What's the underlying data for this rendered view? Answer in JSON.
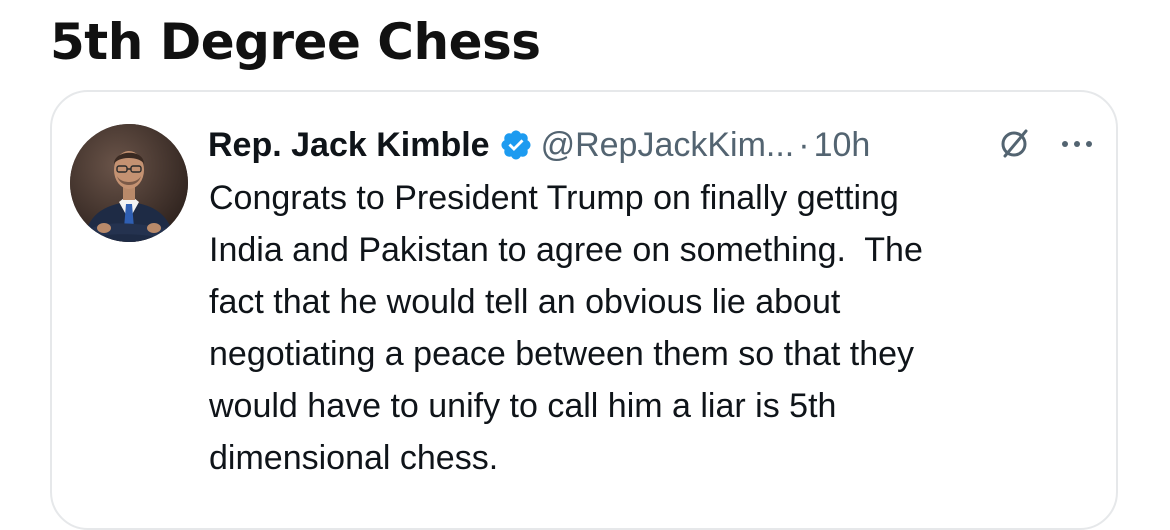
{
  "post": {
    "title": "5th Degree Chess"
  },
  "tweet": {
    "author": {
      "display_name": "Rep. Jack Kimble",
      "verified": true,
      "handle": "@RepJackKim...",
      "avatar_icon": "profile-photo"
    },
    "separator": "·",
    "timestamp": "10h",
    "text": "Congrats to President Trump on finally getting\nIndia and Pakistan to agree on something.  The\nfact that he would tell an obvious lie about\nnegotiating a peace between them so that they\nwould have to unify to call him a liar is 5th\ndimensional chess.",
    "actions": {
      "grok_icon": "grok-icon",
      "more_icon": "more-options-icon"
    }
  },
  "colors": {
    "text_primary": "#0f1419",
    "text_secondary": "#536471",
    "verified_blue": "#1d9bf0",
    "card_border": "#e6e8ea"
  }
}
